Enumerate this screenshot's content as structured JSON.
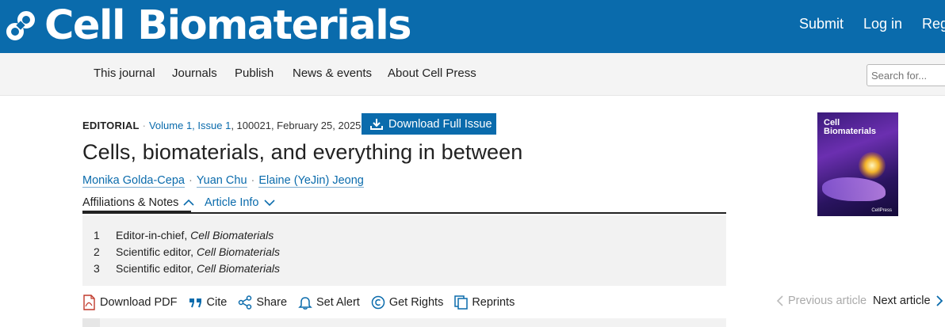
{
  "header": {
    "brand": "Cell Biomaterials",
    "links": [
      "Submit",
      "Log in",
      "Regi"
    ]
  },
  "nav": {
    "items": [
      "This journal",
      "Journals",
      "Publish",
      "News & events",
      "About Cell Press"
    ],
    "search_placeholder": "Search for..."
  },
  "article": {
    "type": "EDITORIAL",
    "volume_issue": "Volume 1, Issue 1",
    "article_number": "100021",
    "date": "February 25, 2025",
    "download_label": "Download Full Issue",
    "title": "Cells, biomaterials, and everything in between",
    "authors": [
      "Monika Golda-Cepa",
      "Yuan Chu",
      "Elaine (YeJin) Jeong"
    ],
    "tabs": [
      "Affiliations & Notes",
      "Article Info"
    ],
    "affiliations": [
      {
        "num": "1",
        "role": "Editor-in-chief,",
        "journal": "Cell Biomaterials"
      },
      {
        "num": "2",
        "role": "Scientific editor,",
        "journal": "Cell Biomaterials"
      },
      {
        "num": "3",
        "role": "Scientific editor,",
        "journal": "Cell Biomaterials"
      }
    ]
  },
  "toolbar": {
    "download_pdf": "Download PDF",
    "cite": "Cite",
    "share": "Share",
    "set_alert": "Set Alert",
    "get_rights": "Get Rights",
    "reprints": "Reprints",
    "previous_article": "Previous article",
    "next_article": "Next article"
  },
  "cover": {
    "title_line1": "Cell",
    "title_line2": "Biomaterials",
    "footer": "CellPress"
  },
  "colors": {
    "brand_blue": "#0a6bac",
    "nav_bg": "#f4f4f4",
    "panel_bg": "#f2f2f2"
  }
}
